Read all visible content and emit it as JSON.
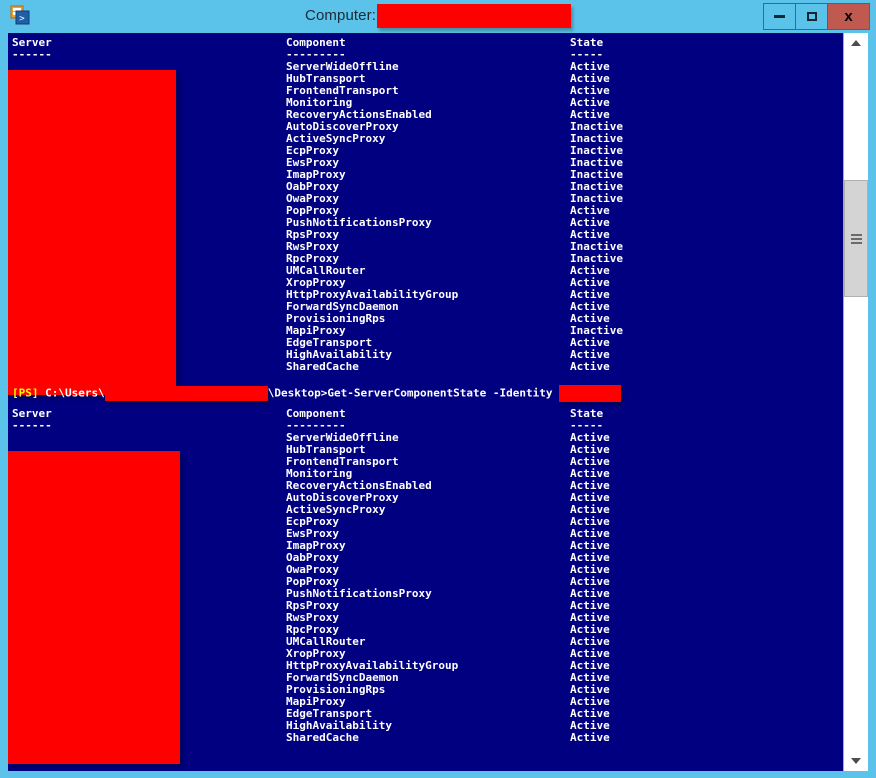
{
  "window": {
    "title_label": "Computer:",
    "icon": "exchange-management-shell-icon",
    "redacted_computer_name": "",
    "buttons": {
      "minimize": "minimize-icon",
      "maximize": "maximize-icon",
      "close": "x"
    }
  },
  "colors": {
    "chrome": "#5bc3ea",
    "console_bg": "#000080",
    "console_fg": "#ffffff",
    "prompt_accent": "#ffff00",
    "redaction": "#ff0000",
    "close_button": "#c05a50"
  },
  "console": {
    "headers": {
      "server": "Server",
      "component": "Component",
      "state": "State"
    },
    "underlines": {
      "server": "------",
      "component": "---------",
      "state": "-----"
    },
    "prompt": {
      "ps_tag": "[PS]",
      "path_prefix": " C:\\Users\\",
      "path_suffix": "\\Desktop>",
      "command": "Get-ServerComponentState -Identity ",
      "full_line": "[PS] C:\\Users\\[REDACTED]\\Desktop>Get-ServerComponentState -Identity [REDACTED]"
    },
    "block1": {
      "rows": [
        {
          "component": "ServerWideOffline",
          "state": "Active"
        },
        {
          "component": "HubTransport",
          "state": "Active"
        },
        {
          "component": "FrontendTransport",
          "state": "Active"
        },
        {
          "component": "Monitoring",
          "state": "Active"
        },
        {
          "component": "RecoveryActionsEnabled",
          "state": "Active"
        },
        {
          "component": "AutoDiscoverProxy",
          "state": "Inactive"
        },
        {
          "component": "ActiveSyncProxy",
          "state": "Inactive"
        },
        {
          "component": "EcpProxy",
          "state": "Inactive"
        },
        {
          "component": "EwsProxy",
          "state": "Inactive"
        },
        {
          "component": "ImapProxy",
          "state": "Inactive"
        },
        {
          "component": "OabProxy",
          "state": "Inactive"
        },
        {
          "component": "OwaProxy",
          "state": "Inactive"
        },
        {
          "component": "PopProxy",
          "state": "Active"
        },
        {
          "component": "PushNotificationsProxy",
          "state": "Active"
        },
        {
          "component": "RpsProxy",
          "state": "Active"
        },
        {
          "component": "RwsProxy",
          "state": "Inactive"
        },
        {
          "component": "RpcProxy",
          "state": "Inactive"
        },
        {
          "component": "UMCallRouter",
          "state": "Active"
        },
        {
          "component": "XropProxy",
          "state": "Active"
        },
        {
          "component": "HttpProxyAvailabilityGroup",
          "state": "Active"
        },
        {
          "component": "ForwardSyncDaemon",
          "state": "Active"
        },
        {
          "component": "ProvisioningRps",
          "state": "Active"
        },
        {
          "component": "MapiProxy",
          "state": "Inactive"
        },
        {
          "component": "EdgeTransport",
          "state": "Active"
        },
        {
          "component": "HighAvailability",
          "state": "Active"
        },
        {
          "component": "SharedCache",
          "state": "Active"
        }
      ]
    },
    "block2": {
      "rows": [
        {
          "component": "ServerWideOffline",
          "state": "Active"
        },
        {
          "component": "HubTransport",
          "state": "Active"
        },
        {
          "component": "FrontendTransport",
          "state": "Active"
        },
        {
          "component": "Monitoring",
          "state": "Active"
        },
        {
          "component": "RecoveryActionsEnabled",
          "state": "Active"
        },
        {
          "component": "AutoDiscoverProxy",
          "state": "Active"
        },
        {
          "component": "ActiveSyncProxy",
          "state": "Active"
        },
        {
          "component": "EcpProxy",
          "state": "Active"
        },
        {
          "component": "EwsProxy",
          "state": "Active"
        },
        {
          "component": "ImapProxy",
          "state": "Active"
        },
        {
          "component": "OabProxy",
          "state": "Active"
        },
        {
          "component": "OwaProxy",
          "state": "Active"
        },
        {
          "component": "PopProxy",
          "state": "Active"
        },
        {
          "component": "PushNotificationsProxy",
          "state": "Active"
        },
        {
          "component": "RpsProxy",
          "state": "Active"
        },
        {
          "component": "RwsProxy",
          "state": "Active"
        },
        {
          "component": "RpcProxy",
          "state": "Active"
        },
        {
          "component": "UMCallRouter",
          "state": "Active"
        },
        {
          "component": "XropProxy",
          "state": "Active"
        },
        {
          "component": "HttpProxyAvailabilityGroup",
          "state": "Active"
        },
        {
          "component": "ForwardSyncDaemon",
          "state": "Active"
        },
        {
          "component": "ProvisioningRps",
          "state": "Active"
        },
        {
          "component": "MapiProxy",
          "state": "Active"
        },
        {
          "component": "EdgeTransport",
          "state": "Active"
        },
        {
          "component": "HighAvailability",
          "state": "Active"
        },
        {
          "component": "SharedCache",
          "state": "Active"
        }
      ]
    }
  },
  "scrollbar": {
    "up_arrow": "chevron-up-icon",
    "down_arrow": "chevron-down-icon",
    "thumb": "scrollbar-thumb"
  }
}
